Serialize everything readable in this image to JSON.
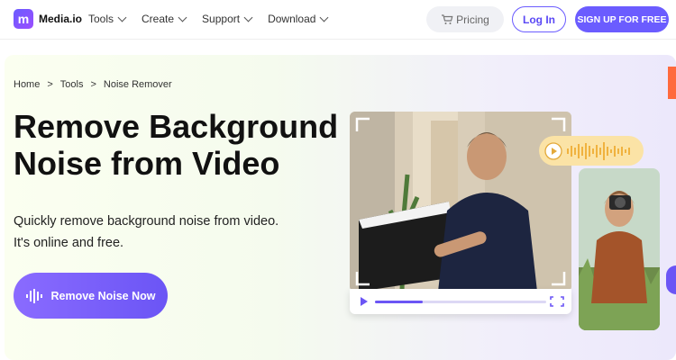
{
  "header": {
    "logo_text": "Media.io",
    "logo_letter": "m",
    "nav": [
      {
        "label": "Tools"
      },
      {
        "label": "Create"
      },
      {
        "label": "Support"
      },
      {
        "label": "Download"
      }
    ],
    "pricing": "Pricing",
    "login": "Log In",
    "signup": "SIGN UP FOR FREE"
  },
  "breadcrumb": {
    "items": [
      "Home",
      "Tools",
      "Noise Remover"
    ],
    "separator": ">"
  },
  "hero": {
    "title_line1": "Remove Background",
    "title_line2": "Noise from Video",
    "subtitle_line1": "Quickly remove background noise from video.",
    "subtitle_line2": "It's online and free.",
    "cta_label": "Remove Noise Now"
  },
  "colors": {
    "accent": "#6b5cff",
    "audio_pill": "#fbe3a6",
    "side_tab": "#ff6a3d"
  },
  "media": {
    "video_progress": 0.28
  }
}
